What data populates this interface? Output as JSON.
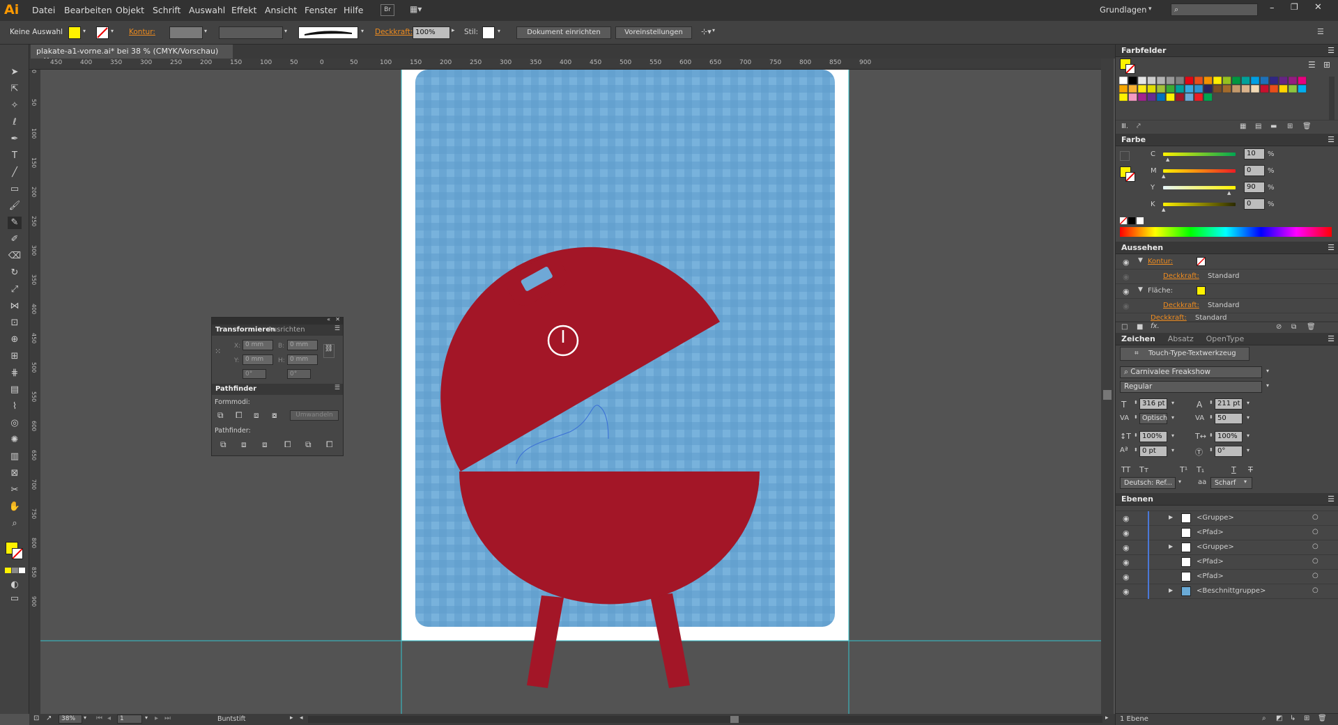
{
  "app": {
    "logo": "Ai",
    "menu": [
      "Datei",
      "Bearbeiten",
      "Objekt",
      "Schrift",
      "Auswahl",
      "Effekt",
      "Ansicht",
      "Fenster",
      "Hilfe"
    ],
    "br": "Br",
    "workspace": "Grundlagen"
  },
  "control": {
    "selection": "Keine Auswahl",
    "kontur": "Kontur:",
    "deckkraft": "Deckkraft:",
    "deckkraft_value": "100%",
    "stil": "Stil:",
    "btn_dokument": "Dokument einrichten",
    "btn_voreinstellungen": "Voreinstellungen"
  },
  "document": {
    "tab": "plakate-a1-vorne.ai* bei 38 % (CMYK/Vorschau)"
  },
  "ruler": {
    "h": [
      "450",
      "400",
      "350",
      "300",
      "250",
      "200",
      "150",
      "100",
      "50",
      "0",
      "50",
      "100",
      "150",
      "200",
      "250",
      "300",
      "350",
      "400",
      "450",
      "500",
      "550",
      "600",
      "650",
      "700",
      "750",
      "800",
      "850",
      "900"
    ],
    "v": [
      "0",
      "50",
      "100",
      "150",
      "200",
      "250",
      "300",
      "350",
      "400",
      "450",
      "500",
      "550",
      "600",
      "650",
      "700",
      "750",
      "800",
      "850",
      "900"
    ]
  },
  "status": {
    "zoom": "38%",
    "page": "1",
    "tool": "Buntstift"
  },
  "transform": {
    "tab1": "Transformieren",
    "tab2": "Ausrichten",
    "x_label": "X:",
    "x": "0 mm",
    "b_label": "B:",
    "b": "0 mm",
    "y_label": "Y:",
    "y": "0 mm",
    "h_label": "H:",
    "h": "0 mm",
    "angle": "0°",
    "shear": "0°"
  },
  "pathfinder": {
    "title": "Pathfinder",
    "formmodi": "Formmodi:",
    "umwandeln": "Umwandeln",
    "pathfinder_label": "Pathfinder:"
  },
  "farbfelder": {
    "title": "Farbfelder"
  },
  "farbe": {
    "title": "Farbe",
    "channels": [
      {
        "label": "C",
        "value": "10",
        "pct": "%"
      },
      {
        "label": "M",
        "value": "0",
        "pct": "%"
      },
      {
        "label": "Y",
        "value": "90",
        "pct": "%"
      },
      {
        "label": "K",
        "value": "0",
        "pct": "%"
      }
    ]
  },
  "aussehen": {
    "title": "Aussehen",
    "rows": [
      {
        "label": "Kontur:",
        "value": ""
      },
      {
        "label": "Deckkraft:",
        "value": "Standard"
      },
      {
        "label": "Fläche:",
        "value": ""
      },
      {
        "label": "Deckkraft:",
        "value": "Standard"
      },
      {
        "label": "Deckkraft:",
        "value": "Standard"
      }
    ]
  },
  "zeichen": {
    "tab1": "Zeichen",
    "tab2": "Absatz",
    "tab3": "OpenType",
    "touch": "Touch-Type-Textwerkzeug",
    "font": "Carnivalee Freakshow",
    "style": "Regular",
    "size": "316 pt",
    "leading": "211 pt",
    "kerning": "Optisch",
    "tracking": "50",
    "vscale": "100%",
    "hscale": "100%",
    "baseline": "0 pt",
    "rotation": "0°",
    "language": "Deutsch: Ref...",
    "aa_label": "aa",
    "antialias": "Scharf"
  },
  "ebenen": {
    "title": "Ebenen",
    "rows": [
      "<Gruppe>",
      "<Pfad>",
      "<Gruppe>",
      "<Pfad>",
      "<Pfad>",
      "<Beschnittgruppe>"
    ],
    "footer": "1 Ebene"
  },
  "colors": {
    "fill": "#fff200",
    "grill": "#a31627",
    "bg_blue": "#6aaad6",
    "accent_orange": "#f08c1e"
  }
}
